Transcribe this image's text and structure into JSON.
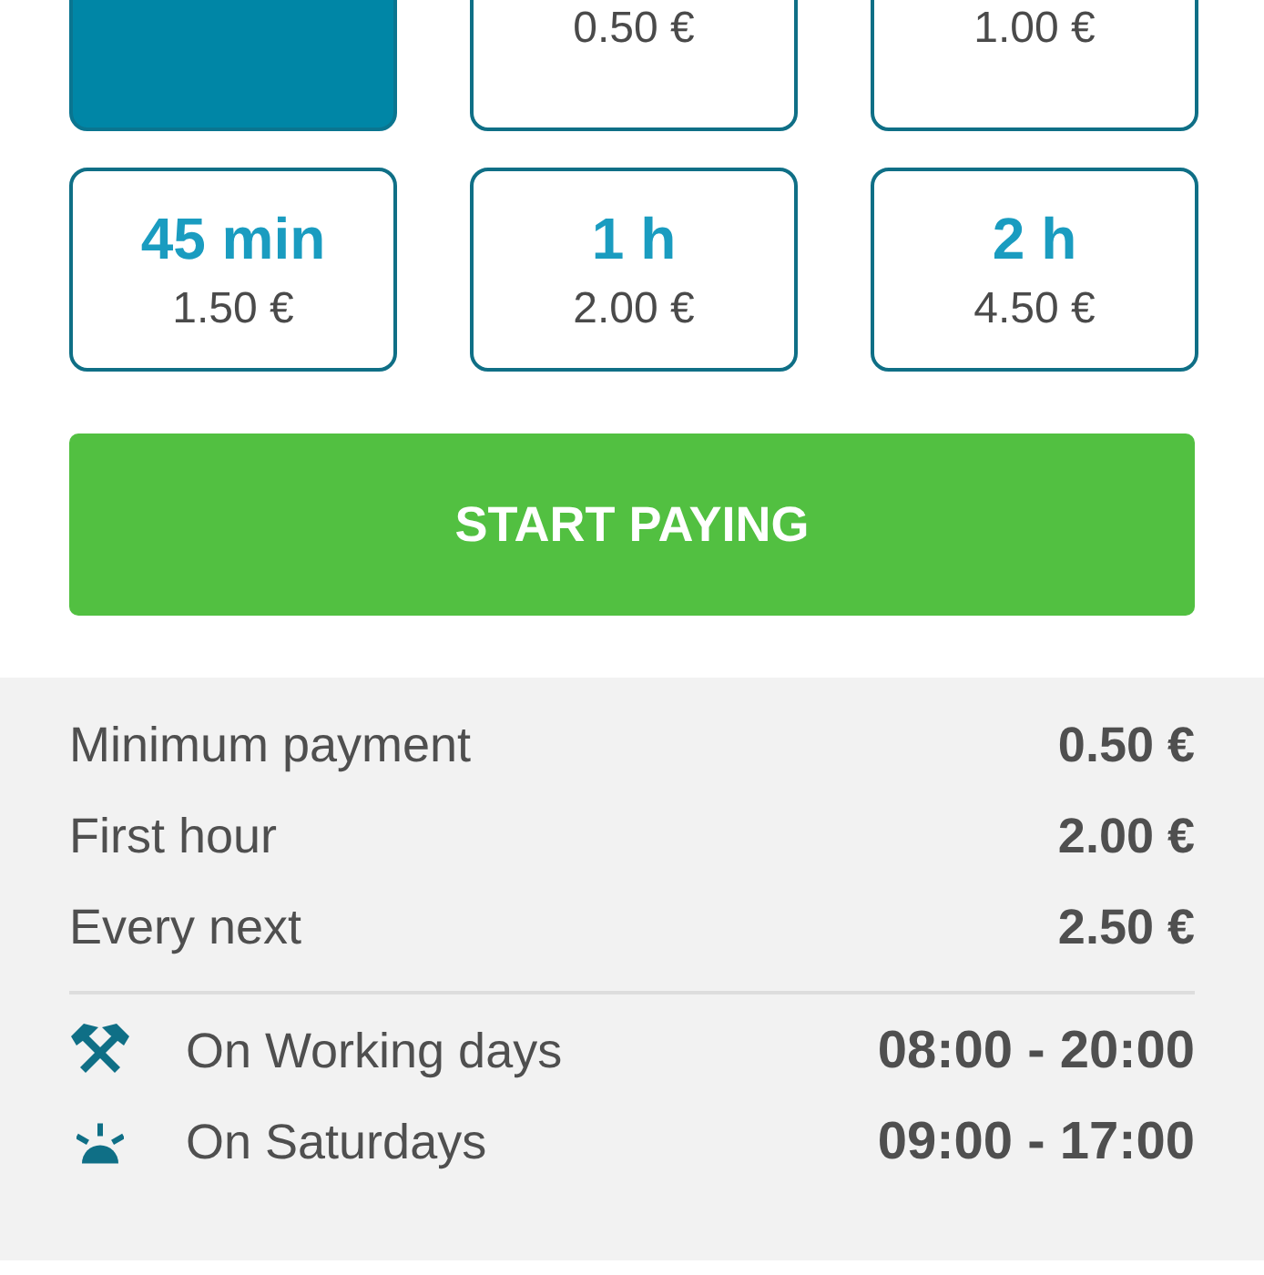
{
  "tariffs": [
    {
      "selected": true
    },
    {
      "selected": false,
      "price": "0.50 €"
    },
    {
      "selected": false,
      "price": "1.00 €"
    },
    {
      "selected": false,
      "duration": "45 min",
      "price": "1.50 €"
    },
    {
      "selected": false,
      "duration": "1 h",
      "price": "2.00 €"
    },
    {
      "selected": false,
      "duration": "2 h",
      "price": "4.50 €"
    }
  ],
  "pay_button": "START PAYING",
  "prices": [
    {
      "label": "Minimum payment",
      "value": "0.50 €"
    },
    {
      "label": "First hour",
      "value": "2.00 €"
    },
    {
      "label": "Every next",
      "value": "2.50 €"
    }
  ],
  "schedule": [
    {
      "kind": "workdays",
      "label": "On Working days",
      "hours": "08:00 - 20:00"
    },
    {
      "kind": "saturday",
      "label": "On Saturdays",
      "hours": "09:00 - 17:00"
    }
  ]
}
